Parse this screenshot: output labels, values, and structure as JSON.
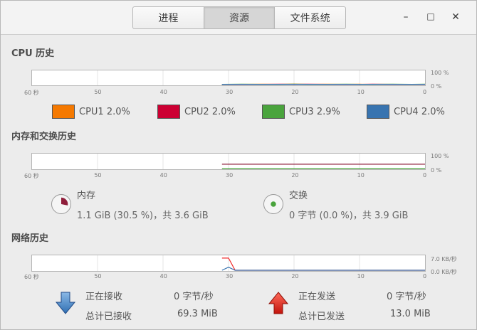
{
  "tabs": [
    "进程",
    "资源",
    "文件系统"
  ],
  "window_controls": {
    "minimize": "–",
    "maximize": "□",
    "close": "✕"
  },
  "cpu": {
    "title": "CPU 历史",
    "x_ticks": [
      "60 秒",
      "50",
      "40",
      "30",
      "20",
      "10",
      "0"
    ],
    "y_ticks": [
      "100 %",
      "0 %"
    ],
    "legend": [
      {
        "label": "CPU1 2.0%",
        "color": "#f57900"
      },
      {
        "label": "CPU2 2.0%",
        "color": "#cc0033"
      },
      {
        "label": "CPU3 2.9%",
        "color": "#4aa43d"
      },
      {
        "label": "CPU4 2.0%",
        "color": "#3874b0"
      }
    ]
  },
  "memory": {
    "title": "内存和交换历史",
    "x_ticks": [
      "60 秒",
      "50",
      "40",
      "30",
      "20",
      "10",
      "0"
    ],
    "y_ticks": [
      "100 %",
      "0 %"
    ],
    "mem_label": "内存",
    "mem_value": "1.1 GiB (30.5 %)，共 3.6 GiB",
    "mem_color": "#8f1e3b",
    "swap_label": "交换",
    "swap_value": "0 字节 (0.0 %)，共 3.9 GiB",
    "swap_color": "#4aa43d"
  },
  "network": {
    "title": "网络历史",
    "x_ticks": [
      "60 秒",
      "50",
      "40",
      "30",
      "20",
      "10",
      "0"
    ],
    "y_ticks": [
      "7.0 KB/秒",
      "0.0 KB/秒"
    ],
    "recv_label": "正在接收",
    "recv_rate": "0 字节/秒",
    "recv_total_label": "总计已接收",
    "recv_total": "69.3 MiB",
    "send_label": "正在发送",
    "send_rate": "0 字节/秒",
    "send_total_label": "总计已发送",
    "send_total": "13.0 MiB",
    "recv_color": "#3874b0",
    "send_color": "#ef2929"
  },
  "chart_data": [
    {
      "type": "line",
      "title": "CPU 历史",
      "xlim": [
        60,
        0
      ],
      "ylim": [
        0,
        100
      ],
      "series": [
        {
          "name": "CPU1",
          "x": [
            31,
            28,
            25,
            22,
            20,
            18,
            15,
            12,
            10,
            8,
            5,
            2,
            0
          ],
          "values": [
            2,
            2,
            3,
            2,
            4,
            2,
            3,
            2,
            3,
            2,
            2,
            2,
            2
          ]
        },
        {
          "name": "CPU2",
          "x": [
            31,
            28,
            25,
            22,
            20,
            18,
            15,
            12,
            10,
            8,
            5,
            2,
            0
          ],
          "values": [
            1,
            2,
            2,
            3,
            2,
            3,
            2,
            2,
            2,
            3,
            2,
            2,
            2
          ]
        },
        {
          "name": "CPU3",
          "x": [
            31,
            28,
            25,
            22,
            20,
            18,
            15,
            12,
            10,
            8,
            5,
            2,
            0
          ],
          "values": [
            2,
            3,
            2,
            2,
            3,
            2,
            2,
            3,
            2,
            2,
            3,
            2,
            3
          ]
        },
        {
          "name": "CPU4",
          "x": [
            31,
            28,
            25,
            22,
            20,
            18,
            15,
            12,
            10,
            8,
            5,
            2,
            0
          ],
          "values": [
            2,
            2,
            2,
            2,
            2,
            2,
            2,
            2,
            2,
            2,
            2,
            2,
            2
          ]
        }
      ]
    },
    {
      "type": "line",
      "title": "内存和交换历史",
      "xlim": [
        60,
        0
      ],
      "ylim": [
        0,
        100
      ],
      "series": [
        {
          "name": "内存",
          "x": [
            31,
            0
          ],
          "values": [
            30.5,
            30.5
          ]
        },
        {
          "name": "交换",
          "x": [
            31,
            0
          ],
          "values": [
            0,
            0
          ]
        }
      ]
    },
    {
      "type": "line",
      "title": "网络历史",
      "xlim": [
        60,
        0
      ],
      "ylim": [
        0,
        7.0
      ],
      "series": [
        {
          "name": "正在发送",
          "x": [
            31,
            30,
            29,
            0
          ],
          "values": [
            6.0,
            6.0,
            0,
            0
          ]
        },
        {
          "name": "正在接收",
          "x": [
            31,
            30,
            29,
            0
          ],
          "values": [
            0,
            1.5,
            0,
            0
          ]
        }
      ]
    }
  ]
}
